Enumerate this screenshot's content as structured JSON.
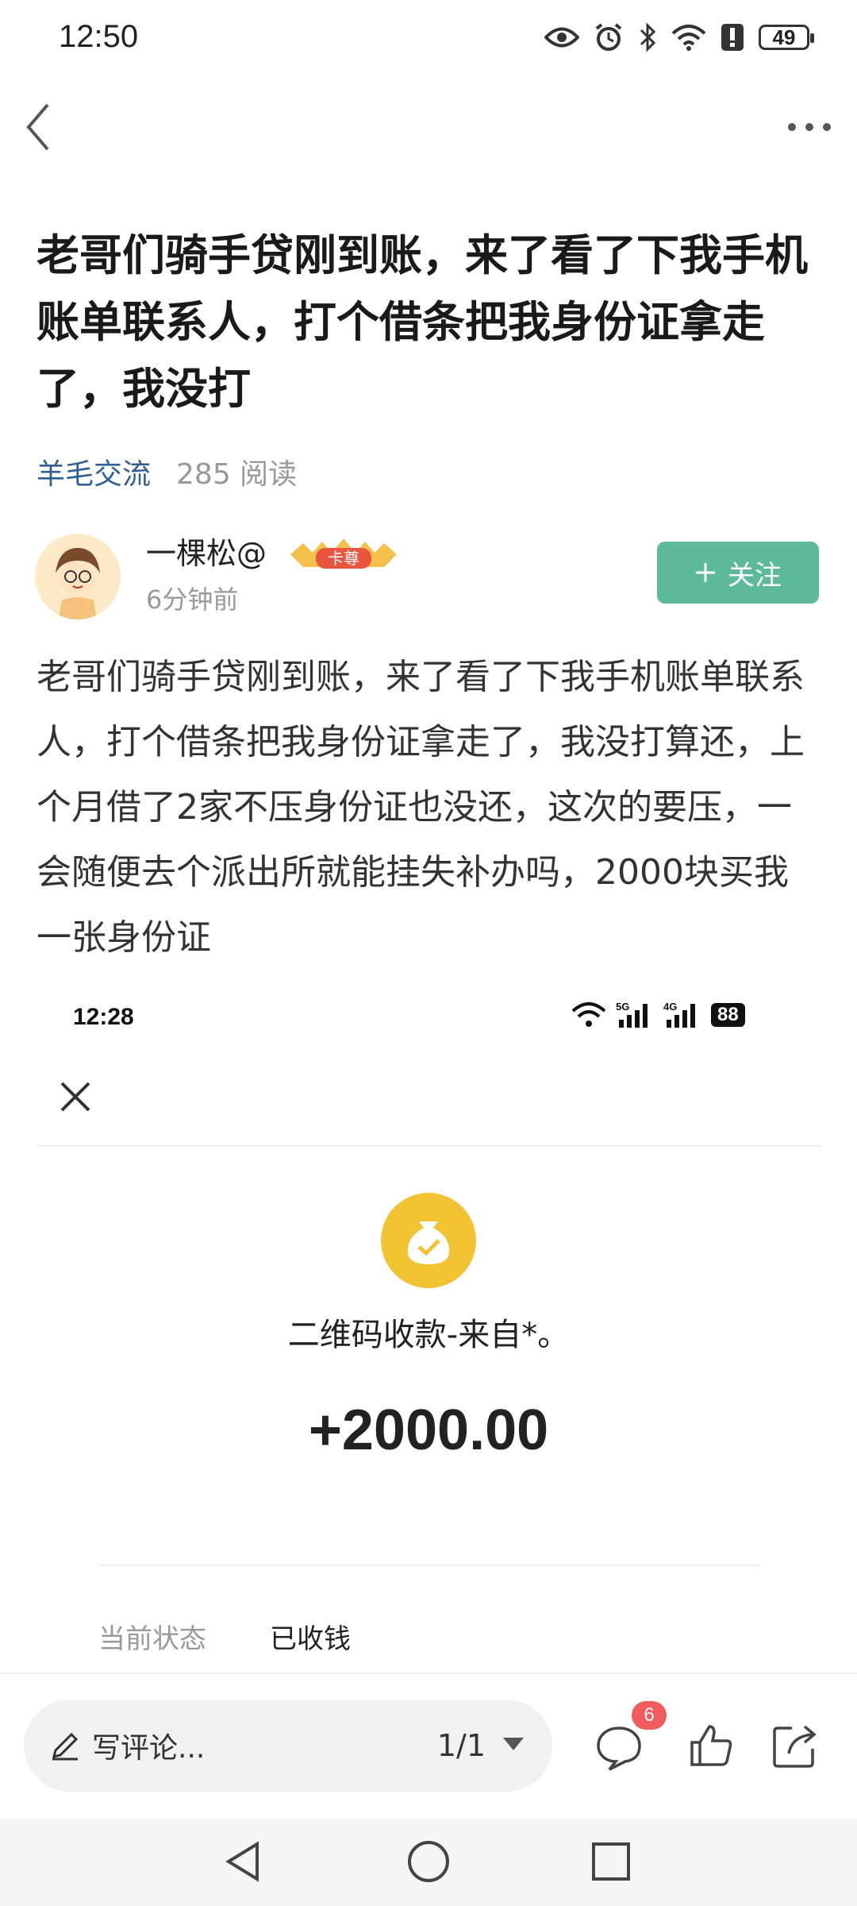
{
  "status_bar": {
    "time": "12:50",
    "battery": "49"
  },
  "post": {
    "title": "老哥们骑手贷刚到账，来了看了下我手机账单联系人，打个借条把我身份证拿走了，我没打",
    "category": "羊毛交流",
    "reads": "285 阅读",
    "body": "老哥们骑手贷刚到账，来了看了下我手机账单联系人，打个借条把我身份证拿走了，我没打算还，上个月借了2家不压身份证也没还，这次的要压，一会随便去个派出所就能挂失补办吗，2000块买我一张身份证"
  },
  "author": {
    "name": "一棵松@",
    "badge": "卡尊",
    "time": "6分钟前",
    "follow_label": "关注"
  },
  "embedded_screenshot": {
    "time": "12:28",
    "net_5g": "5G",
    "net_4g": "4G",
    "battery": "88",
    "description": "二维码收款-来自*。",
    "amount": "+2000.00",
    "status_label": "当前状态",
    "status_value": "已收钱"
  },
  "bottom_bar": {
    "comment_placeholder": "写评论...",
    "page_indicator": "1/1",
    "comment_count": "6"
  },
  "icons": [
    "back-icon",
    "more-icon",
    "eye-icon",
    "alarm-icon",
    "bluetooth-icon",
    "wifi-icon",
    "alert-icon",
    "battery-icon",
    "close-icon",
    "money-bag-icon",
    "pencil-icon",
    "comment-icon",
    "like-icon",
    "share-icon",
    "nav-back-icon",
    "nav-home-icon",
    "nav-recent-icon"
  ],
  "colors": {
    "accent": "#5cb99a",
    "category": "#2f5e92",
    "badge": "#f15b5b",
    "coin": "#f1c232"
  }
}
